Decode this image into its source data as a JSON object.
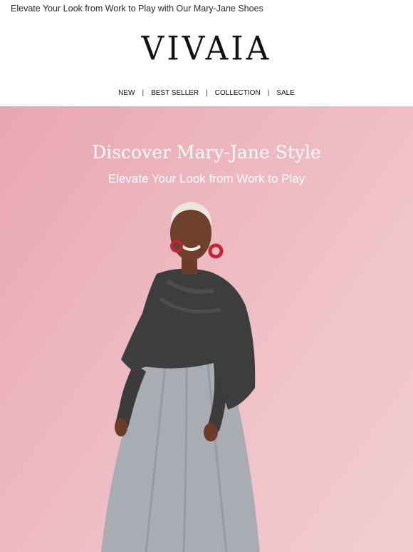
{
  "preheader": "Elevate Your Look from Work to Play with Our Mary-Jane Shoes",
  "brand": "VIVAIA",
  "nav": [
    "NEW",
    "BEST SELLER",
    "COLLECTION",
    "SALE"
  ],
  "nav_separator": "|",
  "hero": {
    "title": "Discover Mary-Jane Style",
    "subtitle": "Elevate Your Look from Work to Play",
    "background_color": "#ecb3bd"
  }
}
